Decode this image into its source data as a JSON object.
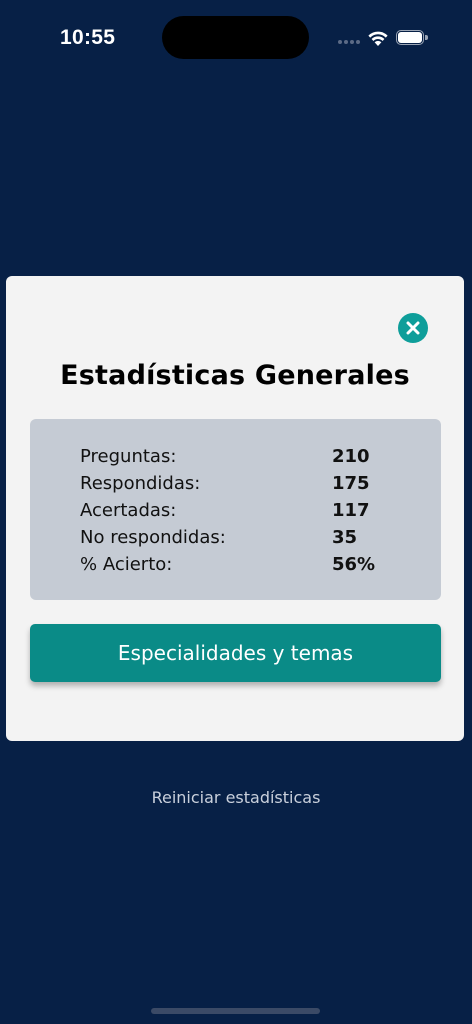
{
  "status_bar": {
    "time": "10:55"
  },
  "modal": {
    "title": "Estadísticas Generales",
    "close_icon": "close-icon",
    "stats": [
      {
        "label": "Preguntas:",
        "value": "210"
      },
      {
        "label": "Respondidas:",
        "value": "175"
      },
      {
        "label": "Acertadas:",
        "value": "117"
      },
      {
        "label": "No respondidas:",
        "value": "35"
      },
      {
        "label": "% Acierto:",
        "value": "56%"
      }
    ],
    "primary_button_label": "Especialidades y temas"
  },
  "reset_link_label": "Reiniciar estadísticas",
  "colors": {
    "background": "#072046",
    "modal_background": "#f3f3f3",
    "stats_box": "#c5cbd4",
    "accent": "#0a8b87",
    "close_button": "#0e9e9a"
  }
}
